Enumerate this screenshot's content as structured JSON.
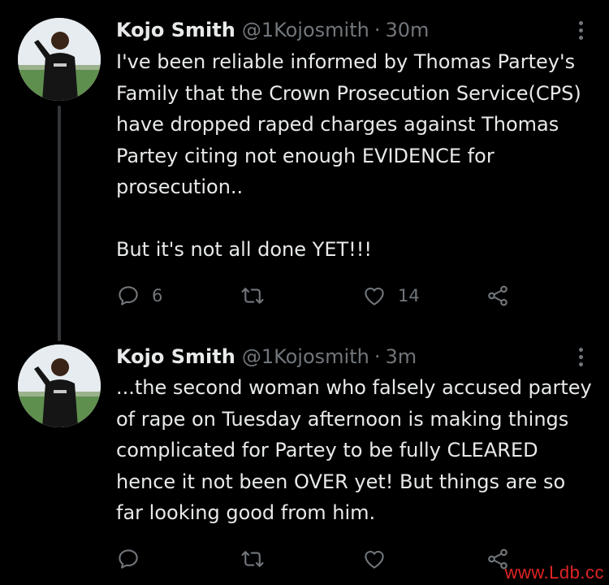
{
  "tweets": [
    {
      "author_name": "Kojo Smith",
      "handle": "@1Kojosmith",
      "separator": "·",
      "time": "30m",
      "text": "I've been reliable informed by Thomas Partey's Family that the Crown Prosecution Service(CPS) have dropped raped charges against Thomas Partey citing not enough EVIDENCE for prosecution..\n\nBut it's not all done YET!!!",
      "reply_count": "6",
      "retweet_count": "",
      "like_count": "14"
    },
    {
      "author_name": "Kojo Smith",
      "handle": "@1Kojosmith",
      "separator": "·",
      "time": "3m",
      "text": "...the second woman who falsely accused partey of rape on Tuesday afternoon is making things complicated for Partey to be fully CLEARED hence it not been OVER yet! But things are so far looking good from him.",
      "reply_count": "",
      "retweet_count": "",
      "like_count": ""
    }
  ],
  "icons": {
    "reply": "reply-icon",
    "retweet": "retweet-icon",
    "like": "like-icon",
    "share": "share-icon",
    "more": "more-icon"
  },
  "colors": {
    "background": "#000000",
    "text_primary": "#e7e9ea",
    "text_secondary": "#71767b",
    "watermark": "#e02424"
  },
  "watermark": "www.Ldb.cc"
}
